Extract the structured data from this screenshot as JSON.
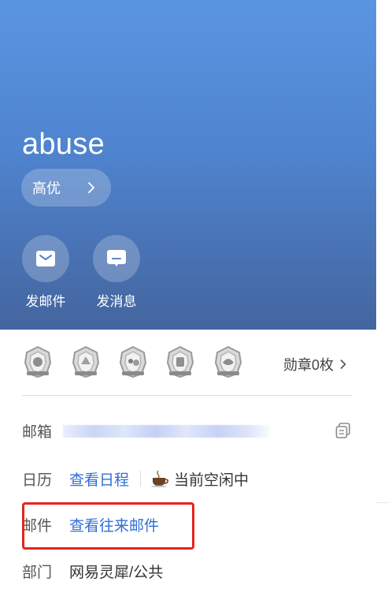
{
  "profile": {
    "name": "abuse",
    "level_label": "高优"
  },
  "actions": {
    "send_mail": "发邮件",
    "send_message": "发消息"
  },
  "badges": {
    "medal_count_label": "勋章0枚",
    "items": [
      "medal-1",
      "medal-2",
      "medal-3",
      "medal-4",
      "medal-5"
    ]
  },
  "details": {
    "email_key": "邮箱",
    "calendar_key": "日历",
    "calendar_link": "查看日程",
    "status_text": "当前空闲中",
    "mail_key": "邮件",
    "mail_link": "查看往来邮件",
    "dept_key": "部门",
    "dept_value": "网易灵犀/公共"
  },
  "colors": {
    "header_top": "#5a95e2",
    "header_bottom": "#44659f",
    "link": "#2f6fd6",
    "highlight": "#e8231f"
  }
}
